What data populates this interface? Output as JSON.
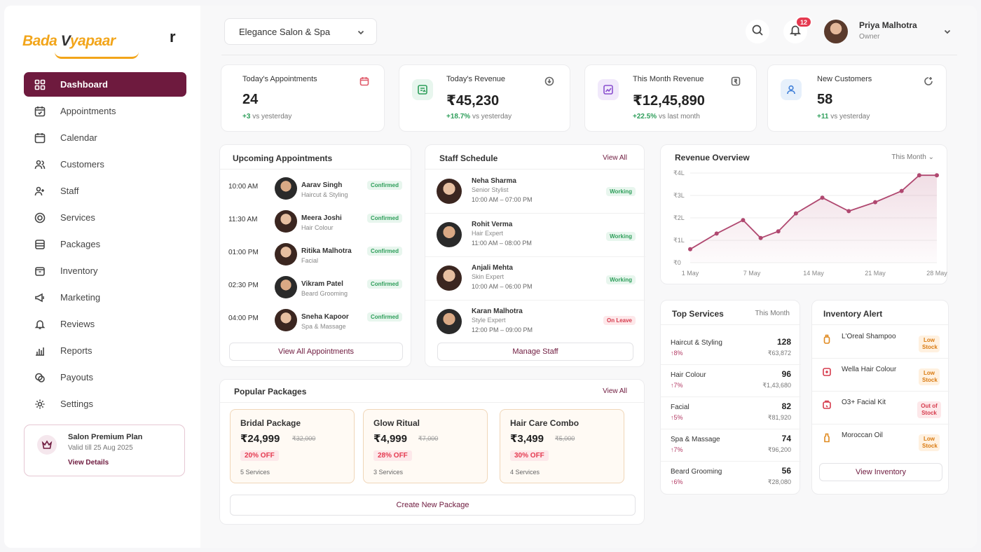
{
  "brand": {
    "logo_main": "Bada",
    "logo_v": "V",
    "logo_rest": "yapaar",
    "logo_tail": "r"
  },
  "sidebar": {
    "items": [
      {
        "label": "Dashboard",
        "icon": "grid-icon",
        "active": true
      },
      {
        "label": "Appointments",
        "icon": "calendar-check-icon"
      },
      {
        "label": "Calendar",
        "icon": "calendar-icon"
      },
      {
        "label": "Customers",
        "icon": "users-icon"
      },
      {
        "label": "Staff",
        "icon": "staff-icon"
      },
      {
        "label": "Services",
        "icon": "target-icon"
      },
      {
        "label": "Packages",
        "icon": "package-icon"
      },
      {
        "label": "Inventory",
        "icon": "box-icon"
      },
      {
        "label": "Marketing",
        "icon": "megaphone-icon"
      },
      {
        "label": "Reviews",
        "icon": "bell-icon"
      },
      {
        "label": "Reports",
        "icon": "bar-chart-icon"
      },
      {
        "label": "Payouts",
        "icon": "coins-icon"
      },
      {
        "label": "Settings",
        "icon": "gear-icon"
      }
    ],
    "plan": {
      "title": "Salon Premium Plan",
      "validity": "Valid till 25 Aug 2025",
      "link": "View Details"
    }
  },
  "header": {
    "salon": "Elegance Salon & Spa",
    "notifications": "12",
    "user_name": "Priya Malhotra",
    "user_role": "Owner"
  },
  "stats": [
    {
      "title": "Today's Appointments",
      "value": "24",
      "delta": "+3",
      "delta_label": "vs yesterday"
    },
    {
      "title": "Today's Revenue",
      "value": "₹45,230",
      "delta": "+18.7%",
      "delta_label": "vs yesterday"
    },
    {
      "title": "This Month Revenue",
      "value": "₹12,45,890",
      "delta": "+22.5%",
      "delta_label": "vs last month"
    },
    {
      "title": "New Customers",
      "value": "58",
      "delta": "+11",
      "delta_label": "vs yesterday"
    }
  ],
  "upcoming": {
    "title": "Upcoming Appointments",
    "button": "View All Appointments",
    "rows": [
      {
        "time": "10:00 AM",
        "name": "Aarav Singh",
        "service": "Haircut & Styling",
        "status": "Confirmed"
      },
      {
        "time": "11:30 AM",
        "name": "Meera Joshi",
        "service": "Hair Colour",
        "status": "Confirmed"
      },
      {
        "time": "01:00 PM",
        "name": "Ritika Malhotra",
        "service": "Facial",
        "status": "Confirmed"
      },
      {
        "time": "02:30 PM",
        "name": "Vikram Patel",
        "service": "Beard Grooming",
        "status": "Confirmed"
      },
      {
        "time": "04:00 PM",
        "name": "Sneha Kapoor",
        "service": "Spa & Massage",
        "status": "Confirmed"
      }
    ]
  },
  "staff": {
    "title": "Staff Schedule",
    "view_all": "View All",
    "button": "Manage Staff",
    "rows": [
      {
        "name": "Neha Sharma",
        "role": "Senior Stylist",
        "time": "10:00 AM – 07:00 PM",
        "status": "Working"
      },
      {
        "name": "Rohit Verma",
        "role": "Hair Expert",
        "time": "11:00 AM – 08:00 PM",
        "status": "Working"
      },
      {
        "name": "Anjali Mehta",
        "role": "Skin Expert",
        "time": "10:00 AM – 06:00 PM",
        "status": "Working"
      },
      {
        "name": "Karan Malhotra",
        "role": "Style Expert",
        "time": "12:00 PM – 09:00 PM",
        "status": "On Leave"
      }
    ]
  },
  "revenue": {
    "title": "Revenue Overview",
    "period": "This Month",
    "chart_data": {
      "type": "line",
      "title": "",
      "xlabel": "",
      "ylabel": "",
      "y_ticks": [
        "₹0",
        "₹1L",
        "₹2L",
        "₹3L",
        "₹4L"
      ],
      "x_ticks": [
        "1 May",
        "7 May",
        "14 May",
        "21 May",
        "28 May"
      ],
      "ylim": [
        0,
        4
      ],
      "x": [
        1,
        4,
        7,
        9,
        11,
        13,
        16,
        19,
        22,
        25,
        27,
        29
      ],
      "values": [
        0.6,
        1.3,
        1.9,
        1.1,
        1.4,
        2.2,
        2.9,
        2.3,
        2.7,
        3.2,
        3.9,
        3.9
      ]
    }
  },
  "packages": {
    "title": "Popular Packages",
    "view_all": "View All",
    "button": "Create New Package",
    "items": [
      {
        "name": "Bridal Package",
        "price": "₹24,999",
        "old": "₹32,000",
        "off": "20% OFF",
        "count": "5 Services"
      },
      {
        "name": "Glow Ritual",
        "price": "₹4,999",
        "old": "₹7,000",
        "off": "28% OFF",
        "count": "3 Services"
      },
      {
        "name": "Hair Care Combo",
        "price": "₹3,499",
        "old": "₹5,000",
        "off": "30% OFF",
        "count": "4 Services"
      }
    ]
  },
  "top_services": {
    "title": "Top Services",
    "period": "This Month",
    "rows": [
      {
        "name": "Haircut & Styling",
        "delta": "↑8%",
        "count": "128",
        "revenue": "₹63,872"
      },
      {
        "name": "Hair Colour",
        "delta": "↑7%",
        "count": "96",
        "revenue": "₹1,43,680"
      },
      {
        "name": "Facial",
        "delta": "↑5%",
        "count": "82",
        "revenue": "₹81,920"
      },
      {
        "name": "Spa & Massage",
        "delta": "↑7%",
        "count": "74",
        "revenue": "₹96,200"
      },
      {
        "name": "Beard Grooming",
        "delta": "↑6%",
        "count": "56",
        "revenue": "₹28,080"
      }
    ]
  },
  "inventory": {
    "title": "Inventory Alert",
    "button": "View Inventory",
    "rows": [
      {
        "name": "L'Oreal Shampoo",
        "status": "Low Stock",
        "tone": "orange"
      },
      {
        "name": "Wella Hair Colour",
        "status": "Low Stock",
        "tone": "orange"
      },
      {
        "name": "O3+ Facial Kit",
        "status": "Out of Stock",
        "tone": "red"
      },
      {
        "name": "Moroccan Oil",
        "status": "Low Stock",
        "tone": "orange"
      }
    ]
  },
  "colors": {
    "accent": "#6e1a3e",
    "positive": "#2e9e5a",
    "danger": "#e53950",
    "chart_line": "#b04870"
  }
}
